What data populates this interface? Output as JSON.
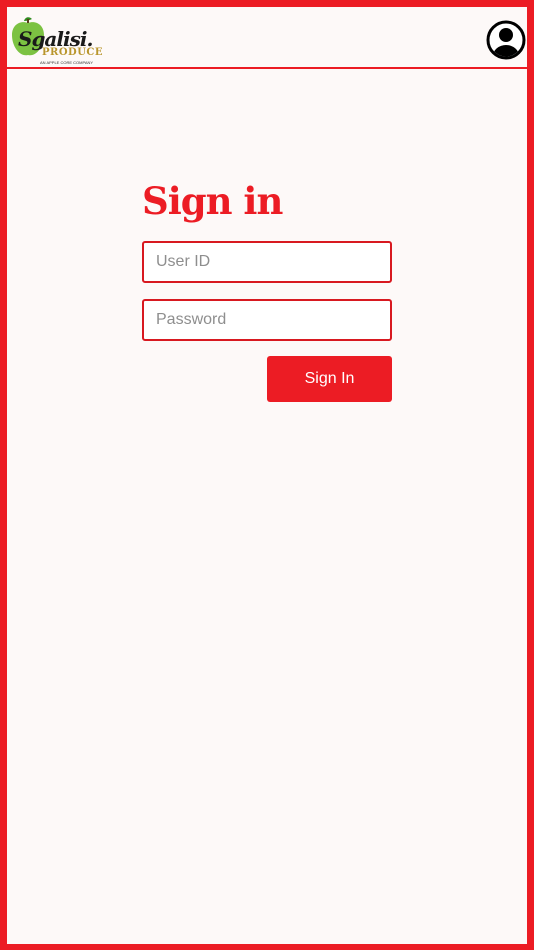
{
  "header": {
    "logo": {
      "brand": "Sgalisi.",
      "sub": "PRODUCE",
      "tagline": "AN APPLE CORE COMPANY"
    },
    "profile_icon": "user-circle-icon"
  },
  "form": {
    "title": "Sign in",
    "user_id": {
      "placeholder": "User ID",
      "value": ""
    },
    "password": {
      "placeholder": "Password",
      "value": ""
    },
    "submit_label": "Sign In"
  },
  "colors": {
    "accent": "#ec1c24",
    "background": "#fdf9f8",
    "border": "#d81920"
  }
}
